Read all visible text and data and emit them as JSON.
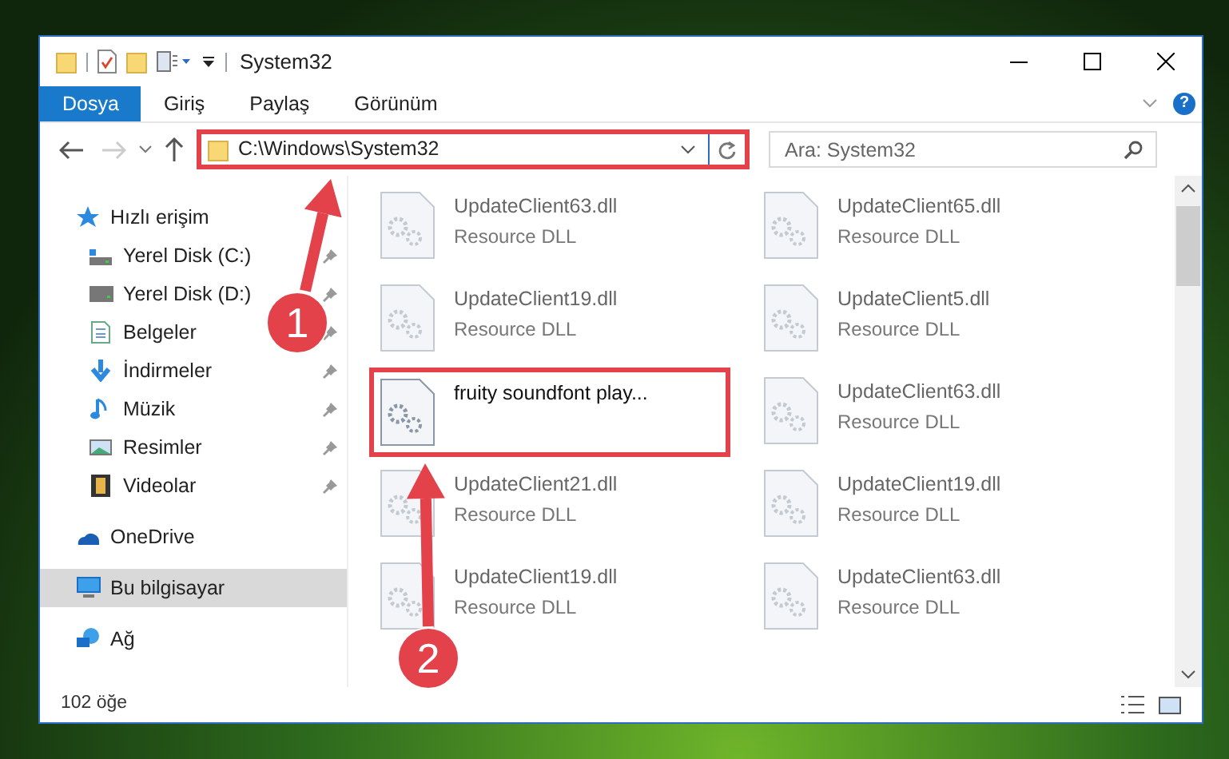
{
  "window": {
    "title": "System32"
  },
  "ribbon_tabs": [
    {
      "label": "Dosya",
      "selected": true
    },
    {
      "label": "Giriş",
      "selected": false
    },
    {
      "label": "Paylaş",
      "selected": false
    },
    {
      "label": "Görünüm",
      "selected": false
    }
  ],
  "help_button": "?",
  "address": "C:\\Windows\\System32",
  "search": {
    "placeholder": "Ara: System32"
  },
  "nav": [
    {
      "label": "Hızlı erişim",
      "kind": "star",
      "selected": false,
      "children": [
        {
          "label": "Yerel Disk (C:)",
          "kind": "drive-c",
          "pinned": true,
          "selected": false
        },
        {
          "label": "Yerel Disk (D:)",
          "kind": "drive",
          "pinned": true,
          "selected": false
        },
        {
          "label": "Belgeler",
          "kind": "doc",
          "pinned": true,
          "selected": false
        },
        {
          "label": "İndirmeler",
          "kind": "download",
          "pinned": true,
          "selected": false
        },
        {
          "label": "Müzik",
          "kind": "music",
          "pinned": true,
          "selected": false
        },
        {
          "label": "Resimler",
          "kind": "picture",
          "pinned": true,
          "selected": false
        },
        {
          "label": "Videolar",
          "kind": "video",
          "pinned": true,
          "selected": false
        }
      ]
    },
    {
      "label": "OneDrive",
      "kind": "cloud",
      "selected": false
    },
    {
      "label": "Bu bilgisayar",
      "kind": "computer",
      "selected": true
    },
    {
      "label": "Ağ",
      "kind": "network",
      "selected": false
    }
  ],
  "files": [
    {
      "name": "UpdateClient63.dll",
      "type": "Resource DLL",
      "blurred": true,
      "highlighted": false
    },
    {
      "name": "UpdateClient65.dll",
      "type": "Resource DLL",
      "blurred": true,
      "highlighted": false
    },
    {
      "name": "UpdateClient19.dll",
      "type": "Resource DLL",
      "blurred": true,
      "highlighted": false
    },
    {
      "name": "UpdateClient5.dll",
      "type": "Resource DLL",
      "blurred": true,
      "highlighted": false
    },
    {
      "name": "fruity soundfont play...",
      "blurred": false,
      "highlighted": true
    },
    {
      "name": "UpdateClient63.dll",
      "type": "Resource DLL",
      "blurred": true,
      "highlighted": false
    },
    {
      "name": "UpdateClient21.dll",
      "type": "Resource DLL",
      "blurred": true,
      "highlighted": false
    },
    {
      "name": "UpdateClient19.dll",
      "type": "Resource DLL",
      "blurred": true,
      "highlighted": false
    },
    {
      "name": "UpdateClient19.dll",
      "type": "Resource DLL",
      "blurred": true,
      "highlighted": false
    },
    {
      "name": "UpdateClient63.dll",
      "type": "Resource DLL",
      "blurred": true,
      "highlighted": false
    }
  ],
  "status_bar": {
    "count": "102 öğe"
  },
  "callouts": [
    {
      "number": "1"
    },
    {
      "number": "2"
    }
  ]
}
